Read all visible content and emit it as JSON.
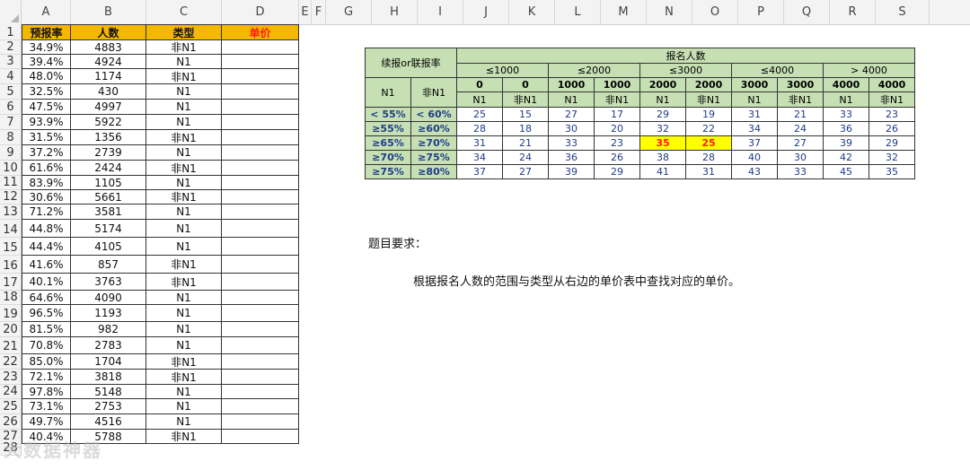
{
  "columns": [
    "A",
    "B",
    "C",
    "D",
    "E",
    "F",
    "G",
    "H",
    "I",
    "J",
    "K",
    "L",
    "M",
    "N",
    "O",
    "P",
    "Q",
    "R",
    "S"
  ],
  "row_numbers": [
    "1",
    "2",
    "3",
    "4",
    "5",
    "6",
    "7",
    "8",
    "9",
    "10",
    "11",
    "12",
    "13",
    "14",
    "15",
    "16",
    "17",
    "18",
    "19",
    "20",
    "21",
    "22",
    "23",
    "24",
    "25",
    "26",
    "27",
    "28"
  ],
  "data_table": {
    "headers": [
      "预报率",
      "人数",
      "类型",
      "单价"
    ],
    "rows": [
      [
        "34.9%",
        "4883",
        "非N1"
      ],
      [
        "39.4%",
        "4924",
        "N1"
      ],
      [
        "48.0%",
        "1174",
        "非N1"
      ],
      [
        "32.5%",
        "430",
        "N1"
      ],
      [
        "47.5%",
        "4997",
        "N1"
      ],
      [
        "93.9%",
        "5922",
        "N1"
      ],
      [
        "31.5%",
        "1356",
        "非N1"
      ],
      [
        "37.2%",
        "2739",
        "N1"
      ],
      [
        "61.6%",
        "2424",
        "非N1"
      ],
      [
        "83.9%",
        "1105",
        "N1"
      ],
      [
        "30.6%",
        "5661",
        "非N1"
      ],
      [
        "71.2%",
        "3581",
        "N1"
      ],
      [
        "44.8%",
        "5174",
        "N1"
      ],
      [
        "44.4%",
        "4105",
        "N1"
      ],
      [
        "41.6%",
        "857",
        "非N1"
      ],
      [
        "40.1%",
        "3763",
        "非N1"
      ],
      [
        "64.6%",
        "4090",
        "N1"
      ],
      [
        "96.5%",
        "1193",
        "N1"
      ],
      [
        "81.5%",
        "982",
        "N1"
      ],
      [
        "70.8%",
        "2783",
        "N1"
      ],
      [
        "85.0%",
        "1704",
        "非N1"
      ],
      [
        "72.1%",
        "3818",
        "非N1"
      ],
      [
        "97.8%",
        "5148",
        "N1"
      ],
      [
        "73.1%",
        "2753",
        "N1"
      ],
      [
        "49.7%",
        "4516",
        "N1"
      ],
      [
        "40.4%",
        "5788",
        "非N1"
      ]
    ]
  },
  "price_table": {
    "corner": "续报or联报率",
    "group_header": "报名人数",
    "ranges": [
      "≤1000",
      "≤2000",
      "≤3000",
      "≤4000",
      "> 4000"
    ],
    "thresholds": [
      "0",
      "0",
      "1000",
      "1000",
      "2000",
      "2000",
      "3000",
      "3000",
      "4000",
      "4000"
    ],
    "row_header_n1": "N1",
    "row_header_non_n1": "非N1",
    "types": [
      "N1",
      "非N1",
      "N1",
      "非N1",
      "N1",
      "非N1",
      "N1",
      "非N1",
      "N1",
      "非N1"
    ],
    "rows": [
      {
        "a": "< 55%",
        "b": "< 60%",
        "values": [
          "25",
          "15",
          "27",
          "17",
          "29",
          "19",
          "31",
          "21",
          "33",
          "23"
        ]
      },
      {
        "a": "≥55%",
        "b": "≥60%",
        "values": [
          "28",
          "18",
          "30",
          "20",
          "32",
          "22",
          "34",
          "24",
          "36",
          "26"
        ]
      },
      {
        "a": "≥65%",
        "b": "≥70%",
        "values": [
          "31",
          "21",
          "33",
          "23",
          "35",
          "25",
          "37",
          "27",
          "39",
          "29"
        ]
      },
      {
        "a": "≥70%",
        "b": "≥75%",
        "values": [
          "34",
          "24",
          "36",
          "26",
          "38",
          "28",
          "40",
          "30",
          "42",
          "32"
        ]
      },
      {
        "a": "≥75%",
        "b": "≥80%",
        "values": [
          "37",
          "27",
          "39",
          "29",
          "41",
          "31",
          "43",
          "33",
          "45",
          "35"
        ]
      }
    ],
    "highlight": {
      "row": 2,
      "cols": [
        4,
        5
      ]
    }
  },
  "notes": {
    "title": "题目要求：",
    "body": "根据报名人数的范围与类型从右边的单价表中查找对应的单价。"
  },
  "watermark": "大数据神器",
  "colors": {
    "header_orange": "#f5b800",
    "table_green": "#c6e0b4",
    "highlight_yellow": "#ffff00",
    "alert_red": "#ff1a1a"
  }
}
